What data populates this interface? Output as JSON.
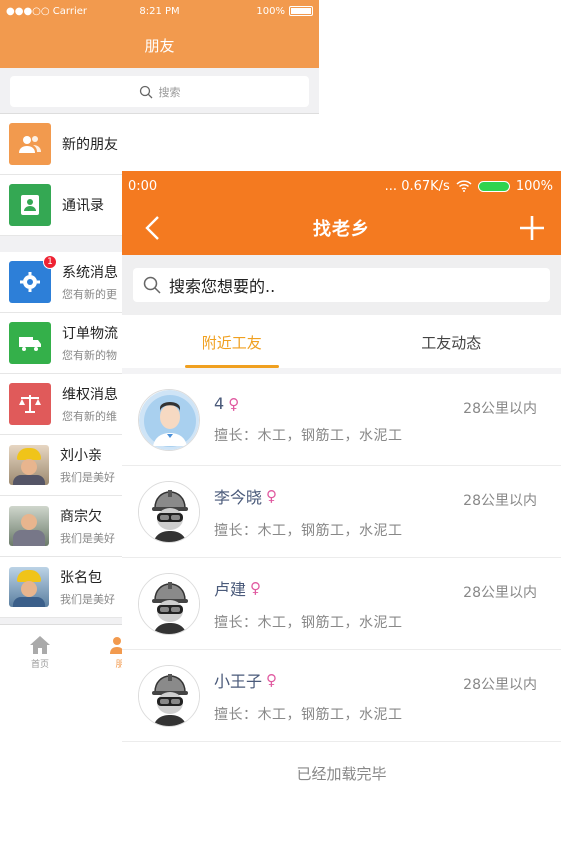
{
  "back_screen": {
    "status": {
      "carrier": "●●●○○ Carrier",
      "time": "8:21 PM",
      "battery": "100%"
    },
    "nav_title": "朋友",
    "search_placeholder": "搜索",
    "items": [
      {
        "label": "新的朋友",
        "icon": "friends-icon",
        "color": "#f29a4e"
      },
      {
        "label": "通讯录",
        "icon": "contacts-icon",
        "color": "#34a853"
      }
    ],
    "messages": [
      {
        "title": "系统消息",
        "sub": "您有新的更",
        "icon": "gear-icon",
        "color": "#2d7fd8",
        "badge": "1"
      },
      {
        "title": "订单物流",
        "sub": "您有新的物",
        "icon": "truck-icon",
        "color": "#34b04a"
      },
      {
        "title": "维权消息",
        "sub": "您有新的维",
        "icon": "scale-icon",
        "color": "#e05a5a"
      },
      {
        "title": "刘小亲",
        "sub": "我们是美好"
      },
      {
        "title": "商宗欠",
        "sub": "我们是美好"
      },
      {
        "title": "张名包",
        "sub": "我们是美好"
      }
    ],
    "tabbar": [
      {
        "label": "首页",
        "icon": "home-icon"
      },
      {
        "label": "朋",
        "icon": "friends-tab-icon"
      }
    ]
  },
  "front_screen": {
    "status": {
      "time": "0:00",
      "speed": "... 0.67K/s",
      "battery": "100%"
    },
    "nav_title": "找老乡",
    "search_placeholder": "搜索您想要的..",
    "tabs": [
      "附近工友",
      "工友动态"
    ],
    "people": [
      {
        "name": "4",
        "sex": "♀",
        "skill": "擅长：木工，钢筋工，水泥工",
        "distance": "28公里以内",
        "avatar": "default"
      },
      {
        "name": "李今晓",
        "sex": "♀",
        "skill": "擅长：木工，钢筋工，水泥工",
        "distance": "28公里以内",
        "avatar": "worker"
      },
      {
        "name": "卢建",
        "sex": "♀",
        "skill": "擅长：木工，钢筋工，水泥工",
        "distance": "28公里以内",
        "avatar": "worker"
      },
      {
        "name": "小王子",
        "sex": "♀",
        "skill": "擅长：木工，钢筋工，水泥工",
        "distance": "28公里以内",
        "avatar": "worker"
      }
    ],
    "footer": "已经加载完毕",
    "colors": {
      "brand": "#f47a20",
      "active_tab": "#f0a020"
    }
  }
}
